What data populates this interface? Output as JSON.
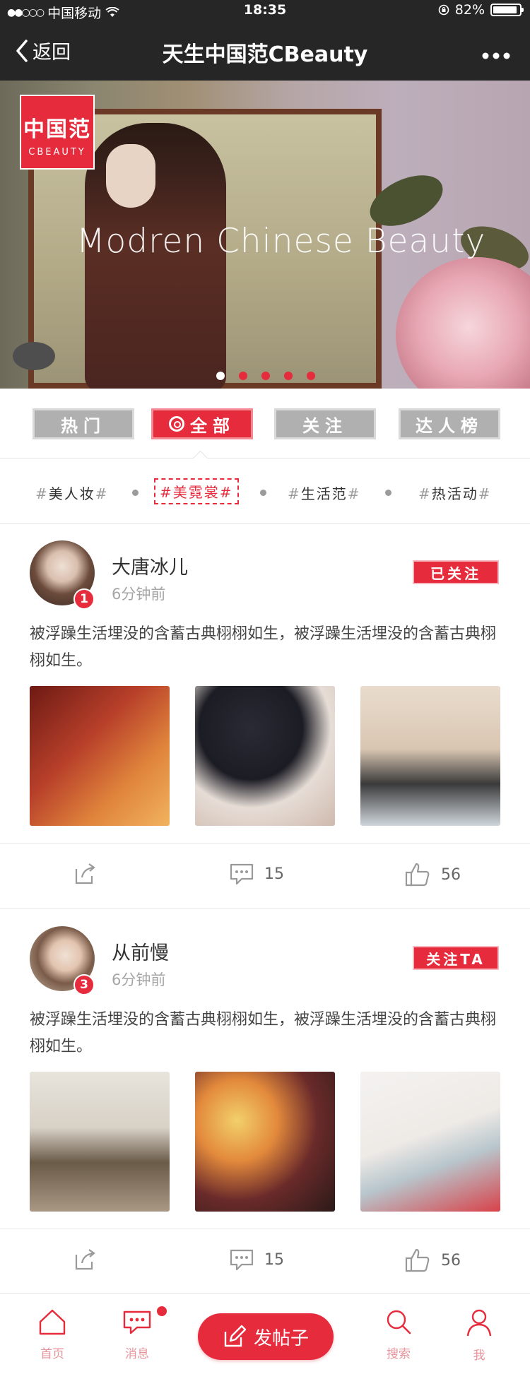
{
  "status_bar": {
    "carrier": "中国移动",
    "time": "18:35",
    "battery": "82%"
  },
  "nav": {
    "back_label": "返回",
    "title": "天生中国范CBeauty"
  },
  "hero": {
    "logo_cn": "中国范",
    "logo_en": "CBEAUTY",
    "slogan": "Modren Chinese Beauty",
    "page_count": 5,
    "active_page": 1
  },
  "tabs": [
    {
      "label": "热门",
      "active": false
    },
    {
      "label": "全部",
      "active": true
    },
    {
      "label": "关注",
      "active": false
    },
    {
      "label": "达人榜",
      "active": false
    }
  ],
  "subtabs": [
    {
      "label": "美人妆",
      "active": false
    },
    {
      "label": "美霓裳",
      "active": true
    },
    {
      "label": "生活范",
      "active": false
    },
    {
      "label": "热活动",
      "active": false
    }
  ],
  "posts": [
    {
      "username": "大唐冰儿",
      "time": "6分钟前",
      "rank": "1",
      "follow_label": "已关注",
      "text": "被浮躁生活埋没的含蓄古典栩栩如生，被浮躁生活埋没的含蓄古典栩栩如生。",
      "comments": "15",
      "likes": "56"
    },
    {
      "username": "从前慢",
      "time": "6分钟前",
      "rank": "3",
      "follow_label": "关注TA",
      "text": "被浮躁生活埋没的含蓄古典栩栩如生，被浮躁生活埋没的含蓄古典栩栩如生。",
      "comments": "15",
      "likes": "56"
    }
  ],
  "tabbar": {
    "home": "首页",
    "messages": "消息",
    "post": "发帖子",
    "search": "搜索",
    "me": "我"
  },
  "colors": {
    "accent": "#e52b3c",
    "bar": "#262626"
  }
}
